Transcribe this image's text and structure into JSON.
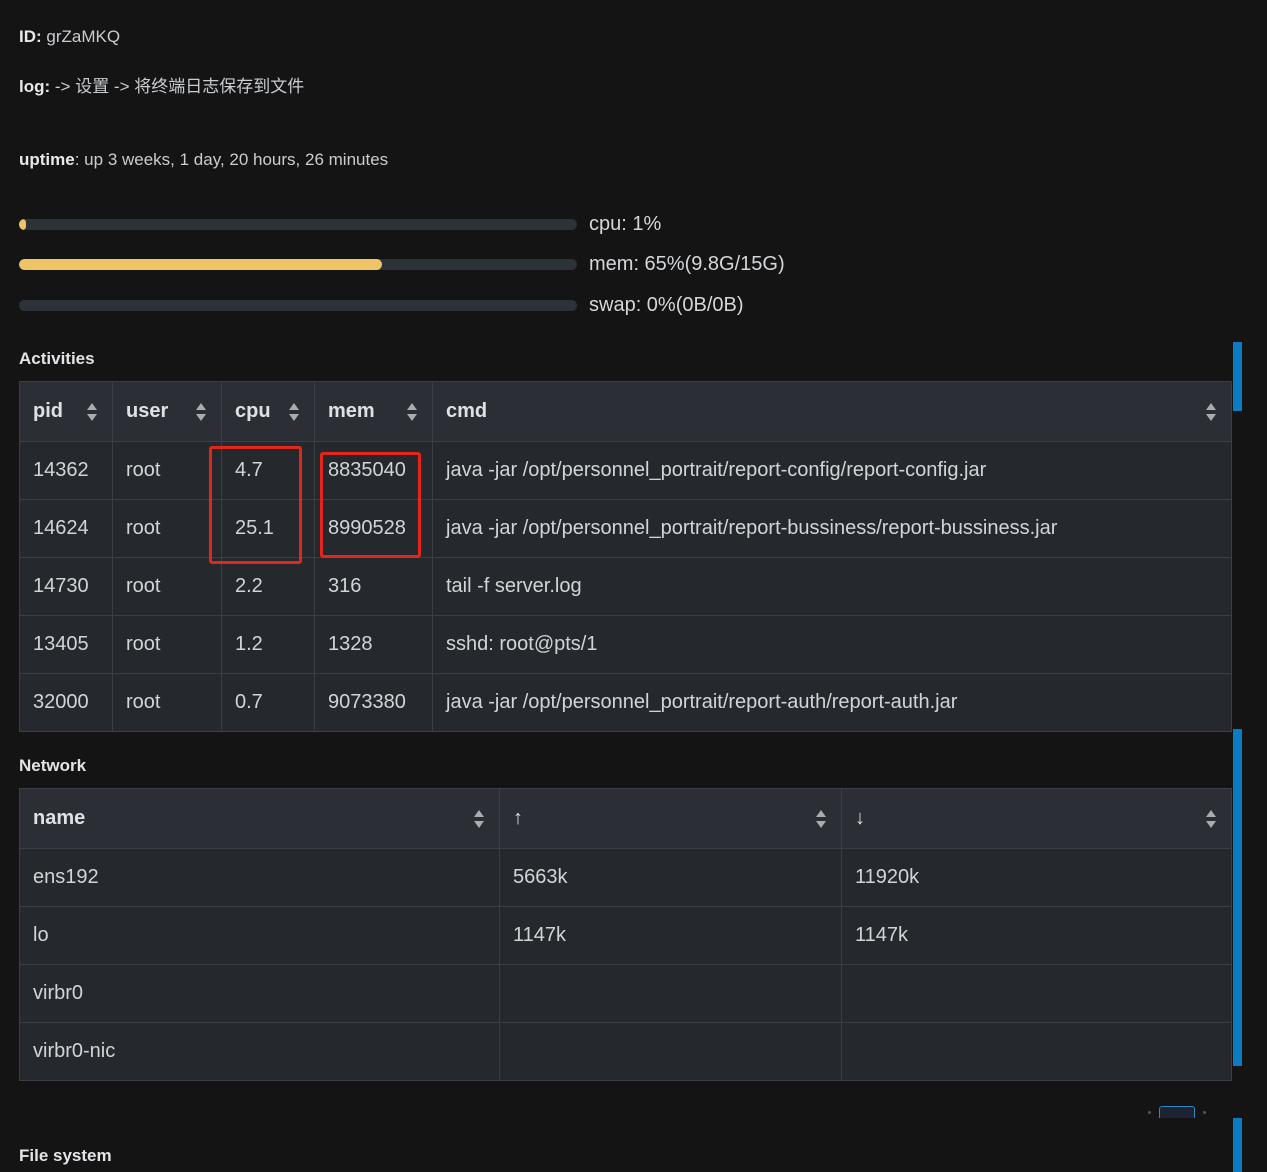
{
  "info": {
    "id_key": "ID:",
    "id_value": "grZaMKQ",
    "log_key": "log:",
    "log_value": "-> 设置 -> 将终端日志保存到文件",
    "uptime_key": "uptime",
    "uptime_value": ": up 3 weeks, 1 day, 20 hours, 26 minutes"
  },
  "resources": {
    "cpu": {
      "label": "cpu: 1%",
      "percent": 1
    },
    "mem": {
      "label": "mem: 65%(9.8G/15G)",
      "percent": 65
    },
    "swap": {
      "label": "swap: 0%(0B/0B)",
      "percent": 0
    }
  },
  "activities": {
    "title": "Activities",
    "columns": [
      "pid",
      "user",
      "cpu",
      "mem",
      "cmd"
    ],
    "rows": [
      [
        "14362",
        "root",
        "4.7",
        "8835040",
        "java -jar /opt/personnel_portrait/report-config/report-config.jar"
      ],
      [
        "14624",
        "root",
        "25.1",
        "8990528",
        "java -jar /opt/personnel_portrait/report-bussiness/report-bussiness.jar"
      ],
      [
        "14730",
        "root",
        "2.2",
        "316",
        "tail -f server.log"
      ],
      [
        "13405",
        "root",
        "1.2",
        "1328",
        "sshd: root@pts/1"
      ],
      [
        "32000",
        "root",
        "0.7",
        "9073380",
        "java -jar /opt/personnel_portrait/report-auth/report-auth.jar"
      ]
    ]
  },
  "network": {
    "title": "Network",
    "columns": [
      "name",
      "↑",
      "↓"
    ],
    "rows": [
      [
        "ens192",
        "5663k",
        "11920k"
      ],
      [
        "lo",
        "1147k",
        "1147k"
      ],
      [
        "virbr0",
        "",
        ""
      ],
      [
        "virbr0-nic",
        "",
        ""
      ]
    ]
  },
  "filesystem": {
    "title": "File system"
  },
  "colors": {
    "background": "#141414",
    "bar_fill": "#efc466",
    "bar_track": "#2d3239",
    "accent": "#0b7bc4",
    "highlight": "#e3261b"
  }
}
